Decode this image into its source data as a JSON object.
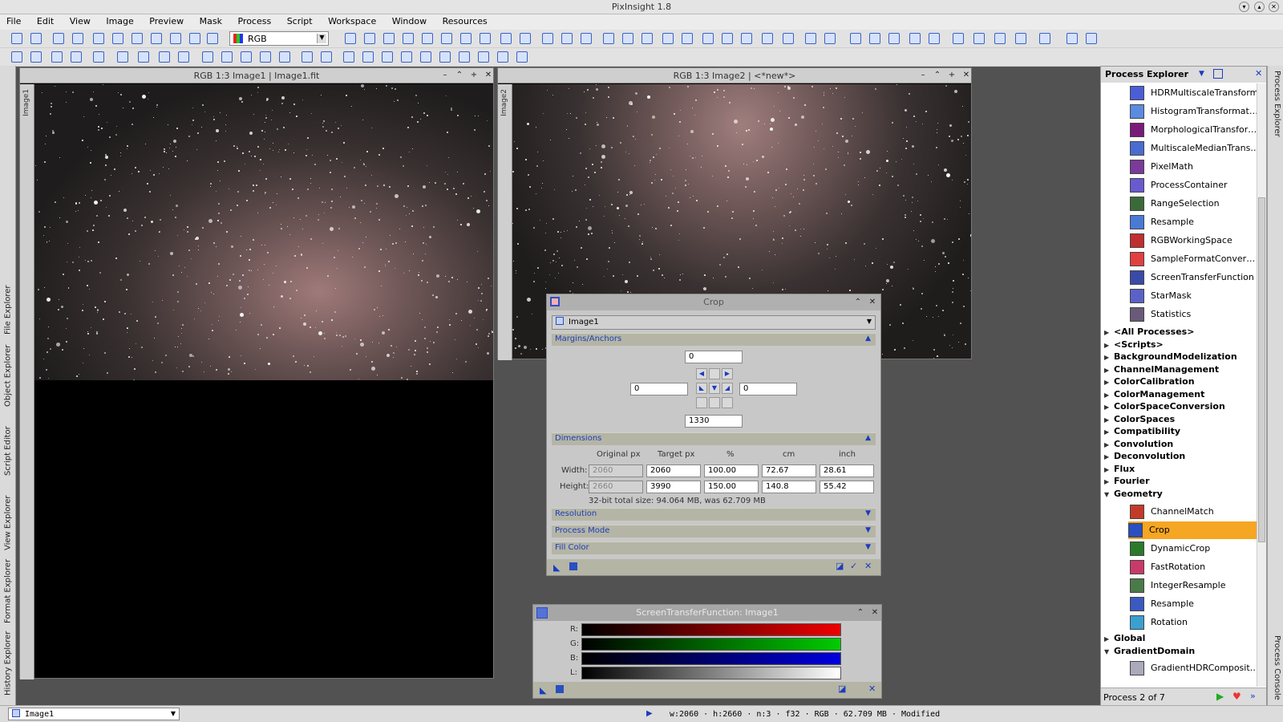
{
  "app": {
    "title": "PixInsight 1.8"
  },
  "menu": [
    "File",
    "Edit",
    "View",
    "Image",
    "Preview",
    "Mask",
    "Process",
    "Script",
    "Workspace",
    "Window",
    "Resources"
  ],
  "toolbar": {
    "channel_combo": "RGB"
  },
  "left_dock": [
    "File Explorer",
    "Object Explorer",
    "Script Editor",
    "View Explorer",
    "Format Explorer",
    "History Explorer"
  ],
  "right_dock": [
    "Process Explorer",
    "Process Console"
  ],
  "image1": {
    "title": "RGB 1:3 Image1 | Image1.fit",
    "tab": "Image1"
  },
  "image2": {
    "title": "RGB 1:3 Image2 | <*new*>",
    "tab": "Image2"
  },
  "crop": {
    "title": "Crop",
    "view": "Image1",
    "margins_label": "Margins/Anchors",
    "top": "0",
    "left": "0",
    "right": "0",
    "bottom": "1330",
    "dimensions_label": "Dimensions",
    "cols": [
      "Original px",
      "Target px",
      "%",
      "cm",
      "inch"
    ],
    "width_label": "Width:",
    "height_label": "Height:",
    "width": {
      "orig": "2060",
      "target": "2060",
      "pct": "100.00",
      "cm": "72.67",
      "inch": "28.61"
    },
    "height": {
      "orig": "2660",
      "target": "3990",
      "pct": "150.00",
      "cm": "140.8",
      "inch": "55.42"
    },
    "size_info": "32-bit total size: 94.064 MB, was 62.709 MB",
    "resolution_label": "Resolution",
    "process_mode_label": "Process Mode",
    "fill_color_label": "Fill Color"
  },
  "stf": {
    "title": "ScreenTransferFunction: Image1",
    "channels": [
      "R:",
      "G:",
      "B:",
      "L:"
    ]
  },
  "process_explorer": {
    "title": "Process Explorer",
    "top_items": [
      "HDRMultiscaleTransform",
      "HistogramTransformat…",
      "MorphologicalTransfor…",
      "MultiscaleMedianTrans…",
      "PixelMath",
      "ProcessContainer",
      "RangeSelection",
      "Resample",
      "RGBWorkingSpace",
      "SampleFormatConver…",
      "ScreenTransferFunction",
      "StarMask",
      "Statistics"
    ],
    "categories": [
      "<All Processes>",
      "<Scripts>",
      "BackgroundModelization",
      "ChannelManagement",
      "ColorCalibration",
      "ColorManagement",
      "ColorSpaceConversion",
      "ColorSpaces",
      "Compatibility",
      "Convolution",
      "Deconvolution",
      "Flux",
      "Fourier",
      "Geometry"
    ],
    "geometry_items": [
      "ChannelMatch",
      "Crop",
      "DynamicCrop",
      "FastRotation",
      "IntegerResample",
      "Resample",
      "Rotation"
    ],
    "bottom_categories": [
      "Global",
      "GradientDomain"
    ],
    "gradient_items": [
      "GradientHDRComposit…"
    ],
    "footer": "Process 2 of 7"
  },
  "statusbar": {
    "view": "Image1",
    "info": "w:2060 · h:2660 · n:3 · f32 · RGB · 62.709 MB · Modified"
  }
}
